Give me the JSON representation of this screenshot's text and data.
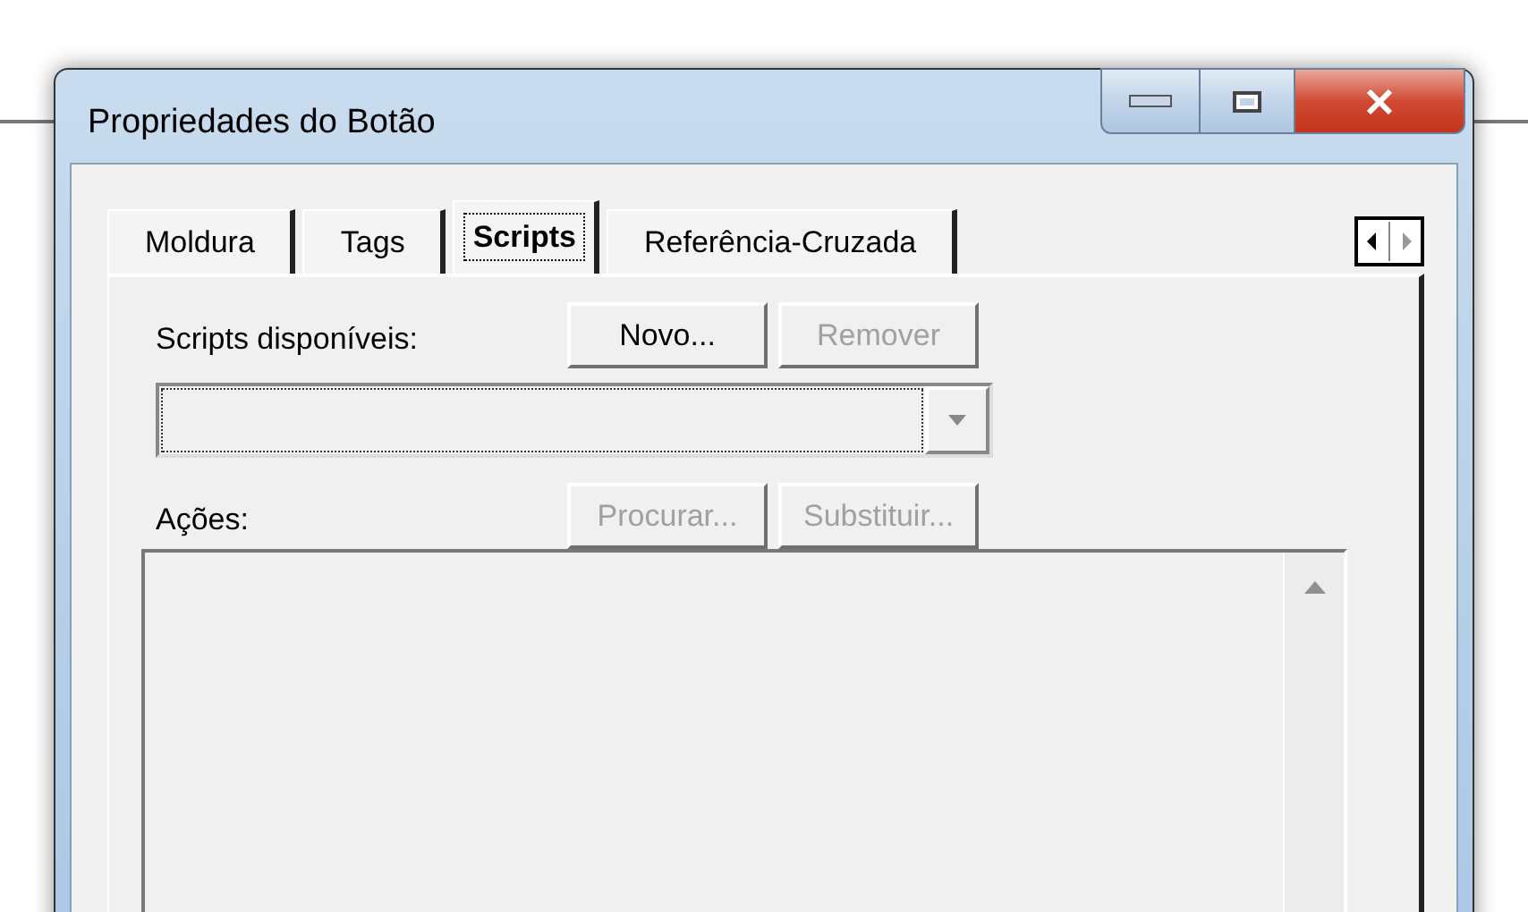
{
  "window": {
    "title": "Propriedades do Botão"
  },
  "tabs": [
    {
      "label": "Moldura",
      "selected": false
    },
    {
      "label": "Tags",
      "selected": false
    },
    {
      "label": "Scripts",
      "selected": true
    },
    {
      "label": "Referência-Cruzada",
      "selected": false
    }
  ],
  "scripts_label": "Scripts disponíveis:",
  "script_buttons": [
    {
      "label": "Novo...",
      "disabled": false
    },
    {
      "label": "Remover",
      "disabled": true
    }
  ],
  "scripts_dropdown": {
    "focused": true
  },
  "actions_label": "Ações:",
  "action_buttons": [
    {
      "label": "Procurar...",
      "disabled": true
    },
    {
      "label": "Substituir...",
      "disabled": true
    }
  ]
}
